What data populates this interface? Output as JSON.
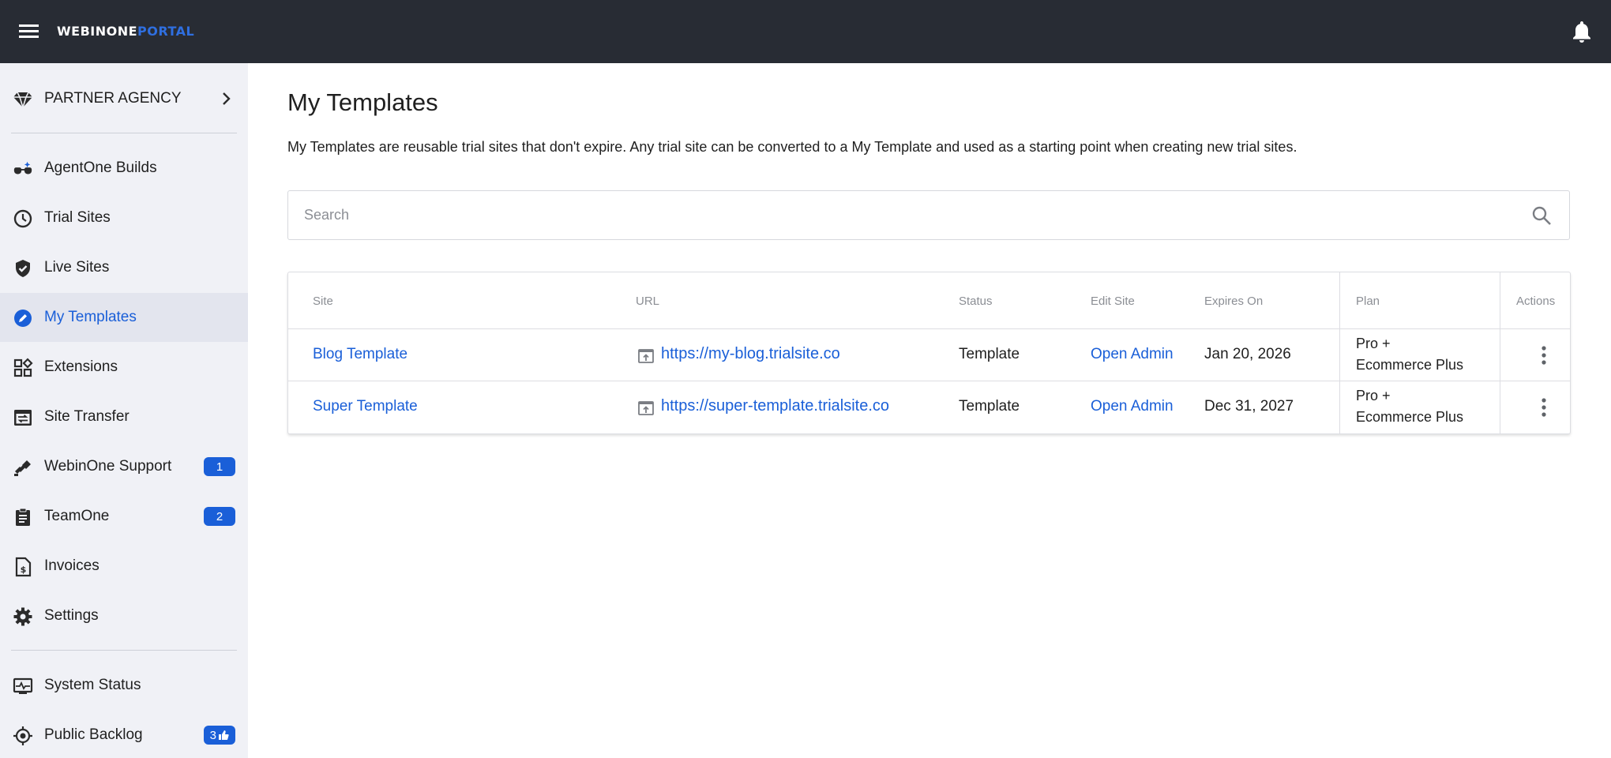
{
  "brand": {
    "name_white": "WEBINONE",
    "name_blue": "PORTAL"
  },
  "colors": {
    "topbar": "#282c34",
    "accent": "#1a5fd8",
    "sidebar_bg": "#f0f1f6"
  },
  "sidebar": {
    "account": "PARTNER AGENCY",
    "items": [
      {
        "label": "AgentOne Builds",
        "icon": "agent-glasses-icon"
      },
      {
        "label": "Trial Sites",
        "icon": "clock-icon"
      },
      {
        "label": "Live Sites",
        "icon": "shield-check-icon"
      },
      {
        "label": "My Templates",
        "icon": "pencil-circle-icon",
        "active": true
      },
      {
        "label": "Extensions",
        "icon": "widgets-icon"
      },
      {
        "label": "Site Transfer",
        "icon": "transfer-icon"
      },
      {
        "label": "WebinOne Support",
        "icon": "ticket-icon",
        "badge": "1"
      },
      {
        "label": "TeamOne",
        "icon": "clipboard-icon",
        "badge": "2"
      },
      {
        "label": "Invoices",
        "icon": "invoice-icon"
      },
      {
        "label": "Settings",
        "icon": "gear-icon"
      },
      {
        "label": "System Status",
        "icon": "monitor-pulse-icon"
      },
      {
        "label": "Public Backlog",
        "icon": "target-icon",
        "badge": "3"
      }
    ]
  },
  "main": {
    "title": "My Templates",
    "description": "My Templates are reusable trial sites that don't expire. Any trial site can be converted to a My Template and used as a starting point when creating new trial sites.",
    "search_placeholder": "Search",
    "table": {
      "headers": {
        "site": "Site",
        "url": "URL",
        "status": "Status",
        "edit": "Edit Site",
        "expires": "Expires On",
        "plan": "Plan",
        "actions": "Actions"
      },
      "rows": [
        {
          "site": "Blog Template",
          "url": "https://my-blog.trialsite.co",
          "status": "Template",
          "edit": "Open Admin",
          "expires": "Jan 20, 2026",
          "plan_line1": "Pro +",
          "plan_line2": "Ecommerce Plus"
        },
        {
          "site": "Super Template",
          "url": "https://super-template.trialsite.co",
          "status": "Template",
          "edit": "Open Admin",
          "expires": "Dec 31, 2027",
          "plan_line1": "Pro +",
          "plan_line2": "Ecommerce Plus"
        }
      ]
    }
  }
}
